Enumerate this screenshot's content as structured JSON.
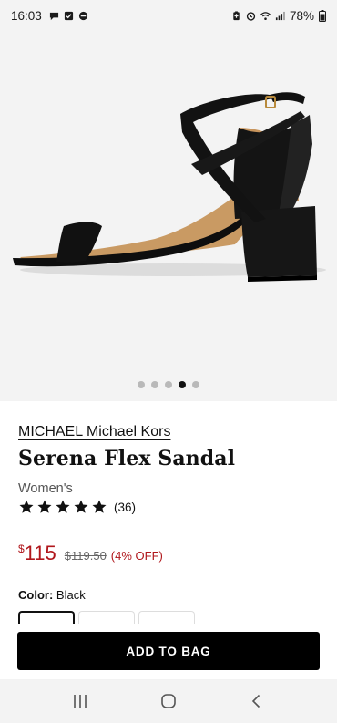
{
  "status_bar": {
    "time": "16:03",
    "battery": "78%",
    "left_icons": [
      "chat-bubble-icon",
      "checkbox-icon",
      "do-not-disturb-icon"
    ],
    "right_icons": [
      "battery-saver-icon",
      "alarm-icon",
      "wifi-icon",
      "signal-icon"
    ]
  },
  "gallery": {
    "image": "black-strappy-block-heel-sandal",
    "dot_count": 5,
    "active_index": 3
  },
  "product": {
    "brand": "MICHAEL Michael Kors",
    "name": "Serena Flex Sandal",
    "gender": "Women's",
    "rating": 5,
    "review_count": "(36)",
    "currency_symbol": "$",
    "price": "115",
    "original_price": "$119.50",
    "discount": "(4% OFF)",
    "color_label": "Color:",
    "color_value": "Black"
  },
  "actions": {
    "add_to_bag": "ADD TO BAG"
  },
  "colors": {
    "sale_red": "#b0161b",
    "button_bg": "#000000",
    "image_bg": "#f3f3f3"
  },
  "nav_bar": {
    "buttons": [
      "recent-apps-icon",
      "home-icon",
      "back-icon"
    ]
  }
}
